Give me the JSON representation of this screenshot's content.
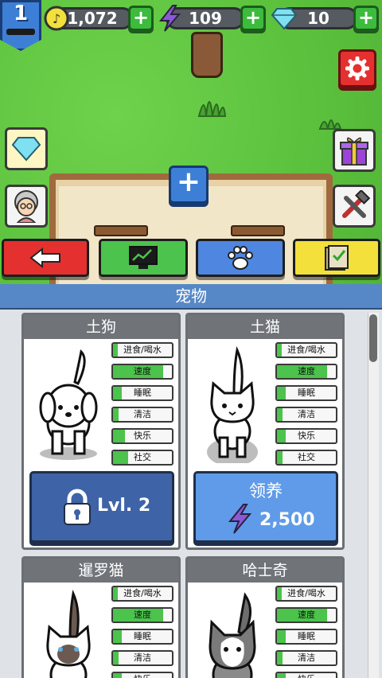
{
  "hud": {
    "level": "1",
    "coins": "1,072",
    "energy": "109",
    "gems": "10",
    "plus_label": "+"
  },
  "scene": {
    "add_label": "+"
  },
  "panel": {
    "title": "宠物"
  },
  "pets": [
    {
      "name": "土狗",
      "stats": [
        {
          "label": "进食/喝水",
          "level": 0.0
        },
        {
          "label": "速度",
          "level": 0.85
        },
        {
          "label": "睡眠",
          "level": 0.15
        },
        {
          "label": "清洁",
          "level": 0.1
        },
        {
          "label": "快乐",
          "level": 0.2
        },
        {
          "label": "社交",
          "level": 0.25
        }
      ],
      "action": {
        "type": "locked",
        "label": "Lvl. 2"
      }
    },
    {
      "name": "土猫",
      "stats": [
        {
          "label": "进食/喝水",
          "level": 0.0
        },
        {
          "label": "速度",
          "level": 0.85
        },
        {
          "label": "睡眠",
          "level": 0.15
        },
        {
          "label": "清洁",
          "level": 0.1
        },
        {
          "label": "快乐",
          "level": 0.15
        },
        {
          "label": "社交",
          "level": 0.1
        }
      ],
      "action": {
        "type": "adopt",
        "label": "领养",
        "price": "2,500"
      }
    },
    {
      "name": "暹罗猫",
      "stats": [
        {
          "label": "进食/喝水",
          "level": 0.0
        },
        {
          "label": "速度",
          "level": 0.85
        },
        {
          "label": "睡眠",
          "level": 0.15
        },
        {
          "label": "清洁",
          "level": 0.1
        },
        {
          "label": "快乐",
          "level": 0.15
        }
      ]
    },
    {
      "name": "哈士奇",
      "stats": [
        {
          "label": "进食/喝水",
          "level": 0.0
        },
        {
          "label": "速度",
          "level": 0.85
        },
        {
          "label": "睡眠",
          "level": 0.15
        },
        {
          "label": "清洁",
          "level": 0.1
        },
        {
          "label": "快乐",
          "level": 0.15
        }
      ]
    }
  ],
  "colors": {
    "grass": "#5cc23e",
    "stat_fill": "#4cc34c",
    "panel_header": "#5688c7"
  },
  "icons": {
    "coin": "coin-icon",
    "energy": "lightning-icon",
    "gem": "diamond-icon",
    "settings": "gear-icon",
    "back": "arrow-left-icon",
    "stats": "monitor-chart-icon",
    "pets": "paw-icon",
    "tasks": "checklist-icon",
    "gift": "gift-icon",
    "build": "hammer-wrench-icon",
    "lock": "lock-icon"
  }
}
